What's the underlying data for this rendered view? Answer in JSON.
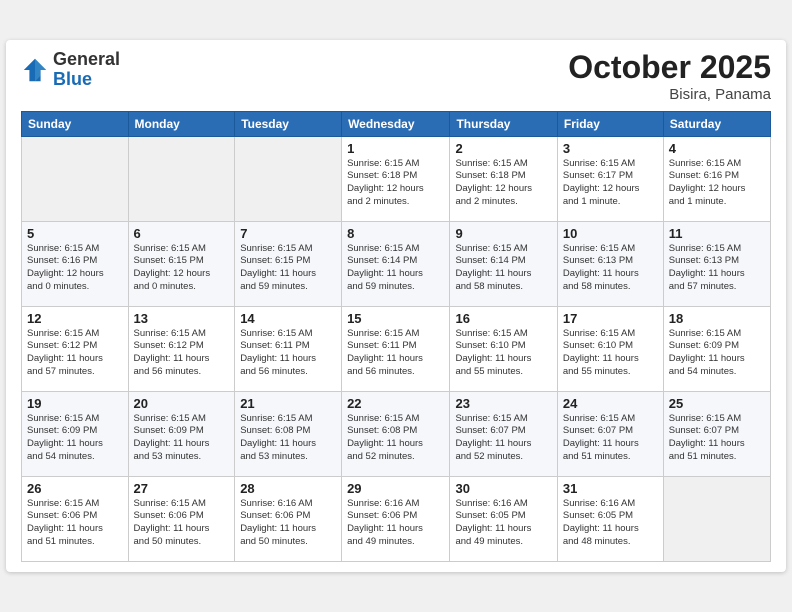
{
  "header": {
    "logo_line1": "General",
    "logo_line2": "Blue",
    "month_title": "October 2025",
    "location": "Bisira, Panama"
  },
  "weekdays": [
    "Sunday",
    "Monday",
    "Tuesday",
    "Wednesday",
    "Thursday",
    "Friday",
    "Saturday"
  ],
  "weeks": [
    [
      {
        "day": "",
        "info": ""
      },
      {
        "day": "",
        "info": ""
      },
      {
        "day": "",
        "info": ""
      },
      {
        "day": "1",
        "info": "Sunrise: 6:15 AM\nSunset: 6:18 PM\nDaylight: 12 hours\nand 2 minutes."
      },
      {
        "day": "2",
        "info": "Sunrise: 6:15 AM\nSunset: 6:18 PM\nDaylight: 12 hours\nand 2 minutes."
      },
      {
        "day": "3",
        "info": "Sunrise: 6:15 AM\nSunset: 6:17 PM\nDaylight: 12 hours\nand 1 minute."
      },
      {
        "day": "4",
        "info": "Sunrise: 6:15 AM\nSunset: 6:16 PM\nDaylight: 12 hours\nand 1 minute."
      }
    ],
    [
      {
        "day": "5",
        "info": "Sunrise: 6:15 AM\nSunset: 6:16 PM\nDaylight: 12 hours\nand 0 minutes."
      },
      {
        "day": "6",
        "info": "Sunrise: 6:15 AM\nSunset: 6:15 PM\nDaylight: 12 hours\nand 0 minutes."
      },
      {
        "day": "7",
        "info": "Sunrise: 6:15 AM\nSunset: 6:15 PM\nDaylight: 11 hours\nand 59 minutes."
      },
      {
        "day": "8",
        "info": "Sunrise: 6:15 AM\nSunset: 6:14 PM\nDaylight: 11 hours\nand 59 minutes."
      },
      {
        "day": "9",
        "info": "Sunrise: 6:15 AM\nSunset: 6:14 PM\nDaylight: 11 hours\nand 58 minutes."
      },
      {
        "day": "10",
        "info": "Sunrise: 6:15 AM\nSunset: 6:13 PM\nDaylight: 11 hours\nand 58 minutes."
      },
      {
        "day": "11",
        "info": "Sunrise: 6:15 AM\nSunset: 6:13 PM\nDaylight: 11 hours\nand 57 minutes."
      }
    ],
    [
      {
        "day": "12",
        "info": "Sunrise: 6:15 AM\nSunset: 6:12 PM\nDaylight: 11 hours\nand 57 minutes."
      },
      {
        "day": "13",
        "info": "Sunrise: 6:15 AM\nSunset: 6:12 PM\nDaylight: 11 hours\nand 56 minutes."
      },
      {
        "day": "14",
        "info": "Sunrise: 6:15 AM\nSunset: 6:11 PM\nDaylight: 11 hours\nand 56 minutes."
      },
      {
        "day": "15",
        "info": "Sunrise: 6:15 AM\nSunset: 6:11 PM\nDaylight: 11 hours\nand 56 minutes."
      },
      {
        "day": "16",
        "info": "Sunrise: 6:15 AM\nSunset: 6:10 PM\nDaylight: 11 hours\nand 55 minutes."
      },
      {
        "day": "17",
        "info": "Sunrise: 6:15 AM\nSunset: 6:10 PM\nDaylight: 11 hours\nand 55 minutes."
      },
      {
        "day": "18",
        "info": "Sunrise: 6:15 AM\nSunset: 6:09 PM\nDaylight: 11 hours\nand 54 minutes."
      }
    ],
    [
      {
        "day": "19",
        "info": "Sunrise: 6:15 AM\nSunset: 6:09 PM\nDaylight: 11 hours\nand 54 minutes."
      },
      {
        "day": "20",
        "info": "Sunrise: 6:15 AM\nSunset: 6:09 PM\nDaylight: 11 hours\nand 53 minutes."
      },
      {
        "day": "21",
        "info": "Sunrise: 6:15 AM\nSunset: 6:08 PM\nDaylight: 11 hours\nand 53 minutes."
      },
      {
        "day": "22",
        "info": "Sunrise: 6:15 AM\nSunset: 6:08 PM\nDaylight: 11 hours\nand 52 minutes."
      },
      {
        "day": "23",
        "info": "Sunrise: 6:15 AM\nSunset: 6:07 PM\nDaylight: 11 hours\nand 52 minutes."
      },
      {
        "day": "24",
        "info": "Sunrise: 6:15 AM\nSunset: 6:07 PM\nDaylight: 11 hours\nand 51 minutes."
      },
      {
        "day": "25",
        "info": "Sunrise: 6:15 AM\nSunset: 6:07 PM\nDaylight: 11 hours\nand 51 minutes."
      }
    ],
    [
      {
        "day": "26",
        "info": "Sunrise: 6:15 AM\nSunset: 6:06 PM\nDaylight: 11 hours\nand 51 minutes."
      },
      {
        "day": "27",
        "info": "Sunrise: 6:15 AM\nSunset: 6:06 PM\nDaylight: 11 hours\nand 50 minutes."
      },
      {
        "day": "28",
        "info": "Sunrise: 6:16 AM\nSunset: 6:06 PM\nDaylight: 11 hours\nand 50 minutes."
      },
      {
        "day": "29",
        "info": "Sunrise: 6:16 AM\nSunset: 6:06 PM\nDaylight: 11 hours\nand 49 minutes."
      },
      {
        "day": "30",
        "info": "Sunrise: 6:16 AM\nSunset: 6:05 PM\nDaylight: 11 hours\nand 49 minutes."
      },
      {
        "day": "31",
        "info": "Sunrise: 6:16 AM\nSunset: 6:05 PM\nDaylight: 11 hours\nand 48 minutes."
      },
      {
        "day": "",
        "info": ""
      }
    ]
  ]
}
